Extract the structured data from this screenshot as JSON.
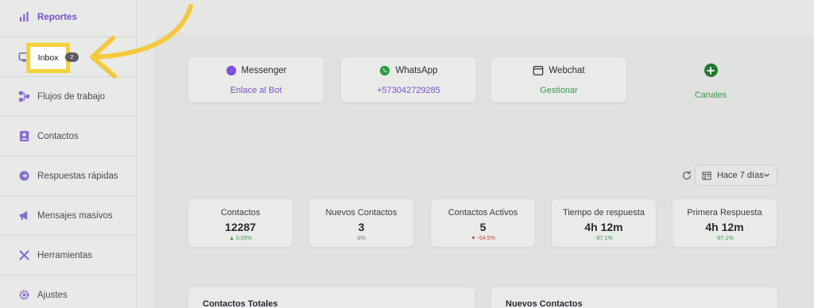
{
  "sidebar": {
    "items": [
      {
        "label": "Reportes",
        "icon": "bar-chart-icon",
        "active": true
      },
      {
        "label": "Inbox",
        "icon": "inbox-icon"
      },
      {
        "label": "Flujos de trabajo",
        "icon": "workflow-icon"
      },
      {
        "label": "Contactos",
        "icon": "contacts-icon"
      },
      {
        "label": "Respuestas rápidas",
        "icon": "quick-replies-icon"
      },
      {
        "label": "Mensajes masivos",
        "icon": "megaphone-icon"
      },
      {
        "label": "Herramientas",
        "icon": "tools-icon"
      },
      {
        "label": "Ajustes",
        "icon": "gear-icon"
      }
    ],
    "inbox_badge": "2"
  },
  "channels": [
    {
      "name": "Messenger",
      "link": "Enlace al Bot",
      "icon": "messenger-icon"
    },
    {
      "name": "WhatsApp",
      "link": "+573042729285",
      "icon": "whatsapp-icon"
    },
    {
      "name": "Webchat",
      "link": "Gestionar",
      "icon": "webchat-icon"
    }
  ],
  "add_channel_label": "Canales",
  "date_range": "Hace 7 días",
  "stats": [
    {
      "title": "Contactos",
      "value": "12287",
      "delta": "0.05%",
      "trend": "up"
    },
    {
      "title": "Nuevos Contactos",
      "value": "3",
      "delta": "0%",
      "trend": "neutral"
    },
    {
      "title": "Contactos Activos",
      "value": "5",
      "delta": "-54.5%",
      "trend": "down"
    },
    {
      "title": "Tiempo de respuesta",
      "value": "4h 12m",
      "delta": "-87.1%",
      "trend": "up"
    },
    {
      "title": "Primera Respuesta",
      "value": "4h 12m",
      "delta": "-87.1%",
      "trend": "up"
    }
  ],
  "bottom_cards": [
    {
      "title": "Contactos Totales"
    },
    {
      "title": "Nuevos Contactos"
    }
  ],
  "colors": {
    "accent_purple": "#7b4fc8",
    "accent_green": "#3a9a4a",
    "highlight_yellow": "#f5d23a",
    "down_red": "#c9423a"
  }
}
